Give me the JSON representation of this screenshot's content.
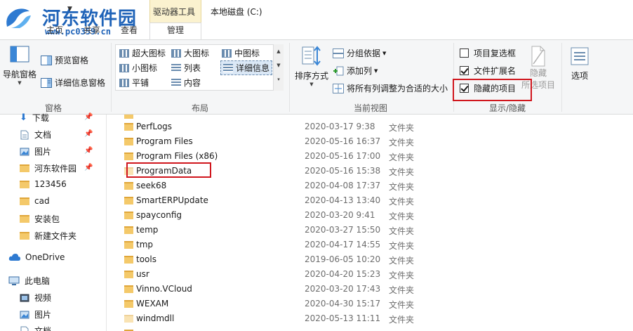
{
  "watermark": {
    "title": "河东软件园",
    "url": "www.pc0359.cn"
  },
  "window": {
    "context_group_label": "驱动器工具",
    "title": "本地磁盘 (C:)"
  },
  "tabs": {
    "home": "主页",
    "share": "共享",
    "view": "查看",
    "manage": "管理"
  },
  "ribbon": {
    "panes": {
      "group_label": "窗格",
      "navigation_pane": "导航窗格",
      "preview_pane": "预览窗格",
      "details_pane": "详细信息窗格"
    },
    "layout": {
      "group_label": "布局",
      "options": [
        "超大图标",
        "大图标",
        "中图标",
        "小图标",
        "列表",
        "详细信息",
        "平铺",
        "内容"
      ],
      "selected": "详细信息"
    },
    "current_view": {
      "group_label": "当前视图",
      "sort_by": "排序方式",
      "group_by": "分组依据",
      "add_columns": "添加列",
      "size_all_columns": "将所有列调整为合适的大小"
    },
    "show_hide": {
      "group_label": "显示/隐藏",
      "item_checkboxes": "项目复选框",
      "item_checkboxes_checked": false,
      "file_extensions": "文件扩展名",
      "file_extensions_checked": true,
      "hidden_items": "隐藏的项目",
      "hidden_items_checked": true,
      "hide_selected_line1": "隐藏",
      "hide_selected_line2": "所选项目",
      "options": "选项"
    }
  },
  "nav": {
    "items": [
      {
        "label": "下载",
        "pinned": true
      },
      {
        "label": "文档",
        "pinned": true
      },
      {
        "label": "图片",
        "pinned": true
      },
      {
        "label": "河东软件园",
        "pinned": true
      },
      {
        "label": "123456",
        "pinned": false
      },
      {
        "label": "cad",
        "pinned": false
      },
      {
        "label": "安装包",
        "pinned": false
      },
      {
        "label": "新建文件夹",
        "pinned": false
      }
    ],
    "onedrive": "OneDrive",
    "this_pc": "此电脑",
    "pc_items": [
      "视频",
      "图片",
      "文档"
    ]
  },
  "files": [
    {
      "name": "PerfLogs",
      "date": "2020-03-17 9:38",
      "type": "文件夹"
    },
    {
      "name": "Program Files",
      "date": "2020-05-16 16:37",
      "type": "文件夹"
    },
    {
      "name": "Program Files (x86)",
      "date": "2020-05-16 17:00",
      "type": "文件夹"
    },
    {
      "name": "ProgramData",
      "date": "2020-05-16 15:38",
      "type": "文件夹"
    },
    {
      "name": "seek68",
      "date": "2020-04-08 17:37",
      "type": "文件夹"
    },
    {
      "name": "SmartERPUpdate",
      "date": "2020-04-13 13:40",
      "type": "文件夹"
    },
    {
      "name": "spayconfig",
      "date": "2020-03-20 9:41",
      "type": "文件夹"
    },
    {
      "name": "temp",
      "date": "2020-03-27 15:50",
      "type": "文件夹"
    },
    {
      "name": "tmp",
      "date": "2020-04-17 14:55",
      "type": "文件夹"
    },
    {
      "name": "tools",
      "date": "2019-06-05 10:20",
      "type": "文件夹"
    },
    {
      "name": "usr",
      "date": "2020-04-20 15:23",
      "type": "文件夹"
    },
    {
      "name": "Vinno.VCloud",
      "date": "2020-03-20 17:43",
      "type": "文件夹"
    },
    {
      "name": "WEXAM",
      "date": "2020-04-30 15:17",
      "type": "文件夹"
    },
    {
      "name": "windmdll",
      "date": "2020-05-13 11:11",
      "type": "文件夹"
    }
  ],
  "colors": {
    "accent": "#1f63b8",
    "highlight_red": "#d0161d",
    "folder": "#f4c96a",
    "context_tab": "#fbf2cf"
  }
}
